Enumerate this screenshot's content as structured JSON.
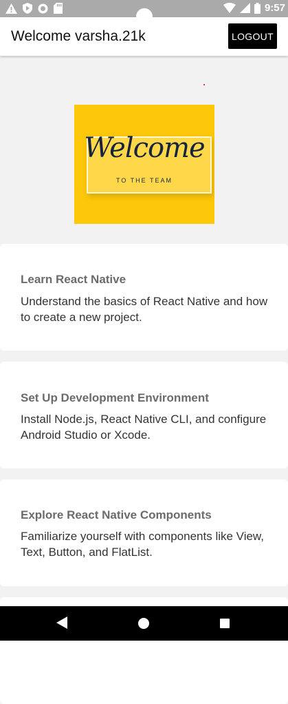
{
  "status_bar": {
    "time": "9:57",
    "left_icons": [
      "warning-icon",
      "shield-icon",
      "record-icon",
      "sd-card-icon"
    ],
    "right_icons": [
      "wifi-icon",
      "signal-icon",
      "battery-icon"
    ]
  },
  "header": {
    "title": "Welcome varsha.21k",
    "logout_label": "LOGOUT"
  },
  "welcome_image": {
    "script_text": "Welcome",
    "sub_text": "TO THE TEAM",
    "background_color": "#fdc80a",
    "text_color": "#16243f"
  },
  "cards": [
    {
      "title": "Learn React Native",
      "description": "Understand the basics of React Native and how to create a new project."
    },
    {
      "title": "Set Up Development Environment",
      "description": "Install Node.js, React Native CLI, and configure Android Studio or Xcode."
    },
    {
      "title": "Explore React Native Components",
      "description": "Familiarize yourself with components like View, Text, Button, and FlatList."
    }
  ],
  "nav_bar": {
    "buttons": [
      "back-icon",
      "home-icon",
      "recent-apps-icon"
    ]
  }
}
